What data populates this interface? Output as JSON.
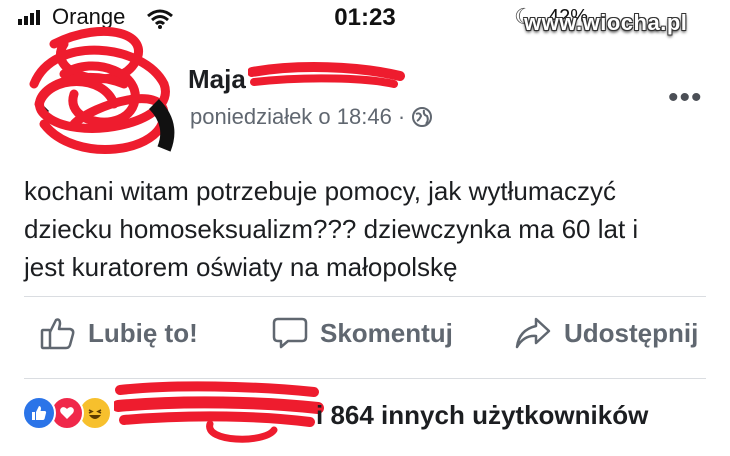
{
  "status_bar": {
    "carrier": "Orange",
    "time": "01:23",
    "battery": "42%",
    "watermark": "www.wiocha.pl"
  },
  "post": {
    "author": "Maja",
    "timestamp": "poniedziałek o 18:46 ·",
    "body_lines": [
      "kochani witam potrzebuje pomocy, jak wytłumaczyć",
      "dziecku homoseksualizm??? dziewczynka ma 60 lat i",
      "jest kuratorem oświaty na małopolskę"
    ]
  },
  "actions": {
    "like": "Lubię to!",
    "comment": "Skomentuj",
    "share": "Udostępnij"
  },
  "reactions": {
    "text": "i 864 innych użytkowników"
  },
  "colors": {
    "redaction": "#ee1c2e",
    "like_blue": "#2b74e8",
    "love_red": "#f0284a",
    "haha_yellow": "#f7c02d",
    "action_gray": "#606770"
  }
}
